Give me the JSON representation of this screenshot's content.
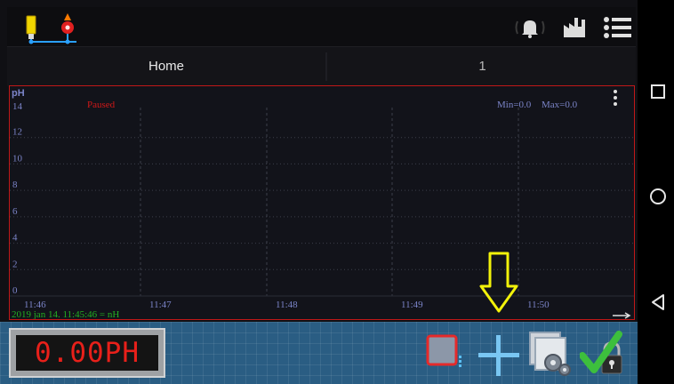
{
  "tabs": [
    {
      "label": "Home"
    },
    {
      "label": "1"
    }
  ],
  "chart_data": {
    "type": "line",
    "ylabel": "pH",
    "ylim": [
      0,
      14
    ],
    "y_ticks": [
      "14",
      "12",
      "10",
      "8",
      "6",
      "4",
      "2",
      "0"
    ],
    "x_ticks": [
      "11:46",
      "11:47",
      "11:48",
      "11:49",
      "11:50"
    ],
    "status": "Paused",
    "min_label": "Min=0.0",
    "max_label": "Max=0.0",
    "footer": "2019 jan 14. 11:45:46 = nH",
    "series": [],
    "grid": true,
    "colors": {
      "status": "#d01818",
      "footer": "#22b022",
      "axis_text": "#7b84c8",
      "grid": "#3c3f4a"
    }
  },
  "display": {
    "value": "0.00PH"
  },
  "colors": {
    "accent_red": "#c01818",
    "annotation_arrow": "#f2f20a",
    "toolbar_bg": "#2a5d83"
  },
  "icons": {
    "topbar": [
      "tank-icon",
      "valve-icon",
      "alarm-bell-icon",
      "factory-icon",
      "menu-icon"
    ],
    "chart": [
      "more-vert-icon",
      "arrow-right-icon"
    ],
    "toolbar": [
      "stop-square-icon",
      "crosshair-plus-icon",
      "settings-window-icon",
      "lock-check-icon"
    ],
    "annotation": [
      "down-arrow-icon"
    ],
    "navbar": [
      "recents-square-icon",
      "home-circle-icon",
      "back-triangle-icon"
    ]
  }
}
